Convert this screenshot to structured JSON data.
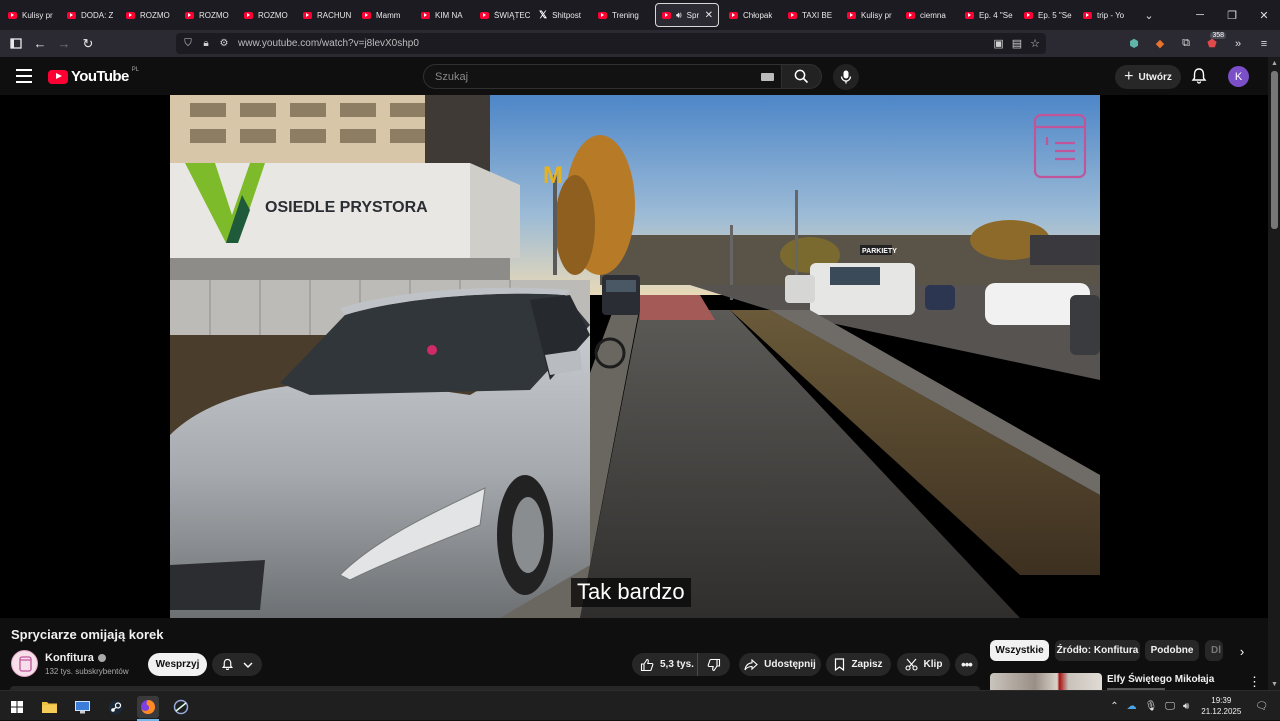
{
  "browser": {
    "tabs": [
      {
        "label": "Kulisy pr",
        "icon": "youtube-icon"
      },
      {
        "label": "DODA: Z",
        "icon": "youtube-icon"
      },
      {
        "label": "ROZMO",
        "icon": "youtube-icon"
      },
      {
        "label": "ROZMO",
        "icon": "youtube-icon"
      },
      {
        "label": "ROZMO",
        "icon": "youtube-icon"
      },
      {
        "label": "RACHUN",
        "icon": "youtube-icon"
      },
      {
        "label": "Mamm",
        "icon": "youtube-icon"
      },
      {
        "label": "KIM NA",
        "icon": "youtube-icon"
      },
      {
        "label": "ŚWIĄTEC",
        "icon": "youtube-icon"
      },
      {
        "label": "Shitpost",
        "icon": "x-icon"
      },
      {
        "label": "Trening",
        "icon": "youtube-icon"
      },
      {
        "label": "Spr",
        "icon": "youtube-icon",
        "active": true
      },
      {
        "label": "Chłopak",
        "icon": "youtube-icon"
      },
      {
        "label": "TAXI BE",
        "icon": "youtube-icon"
      },
      {
        "label": "Kulisy pr",
        "icon": "youtube-icon"
      },
      {
        "label": "ciemna",
        "icon": "youtube-icon"
      },
      {
        "label": "Ep. 4 \"Se",
        "icon": "youtube-icon"
      },
      {
        "label": "Ep. 5 \"Se",
        "icon": "youtube-icon"
      },
      {
        "label": "trip - Yo",
        "icon": "youtube-icon"
      }
    ],
    "url": "www.youtube.com/watch?v=j8levX0shp0",
    "extension_badge": "358"
  },
  "youtube": {
    "logo_text": "YouTube",
    "country_code": "PL",
    "search_placeholder": "Szukaj",
    "create_label": "Utwórz",
    "avatar_letter": "K"
  },
  "video": {
    "caption": "Tak bardzo",
    "scene_sign_text": "OSIEDLE PRYSTORA",
    "scene_sign_small": "PARKIETY"
  },
  "meta": {
    "title": "Spryciarze omijają korek",
    "channel_name": "Konfitura",
    "subscribers": "132 tys. subskrybentów",
    "join_label": "Wesprzyj",
    "likes": "5,3 tys.",
    "share_label": "Udostępnij",
    "save_label": "Zapisz",
    "clip_label": "Klip"
  },
  "chips": [
    "Wszystkie",
    "Źródło: Konfitura",
    "Podobne",
    "Dl"
  ],
  "recommendation": {
    "title": "Elfy Świętego Mikołaja"
  },
  "taskbar": {
    "time": "19:39",
    "date": "21.12.2025"
  },
  "colors": {
    "yt_red": "#ff0033",
    "page_bg": "#0f0f0f",
    "avatar": "#7b4fc7"
  }
}
